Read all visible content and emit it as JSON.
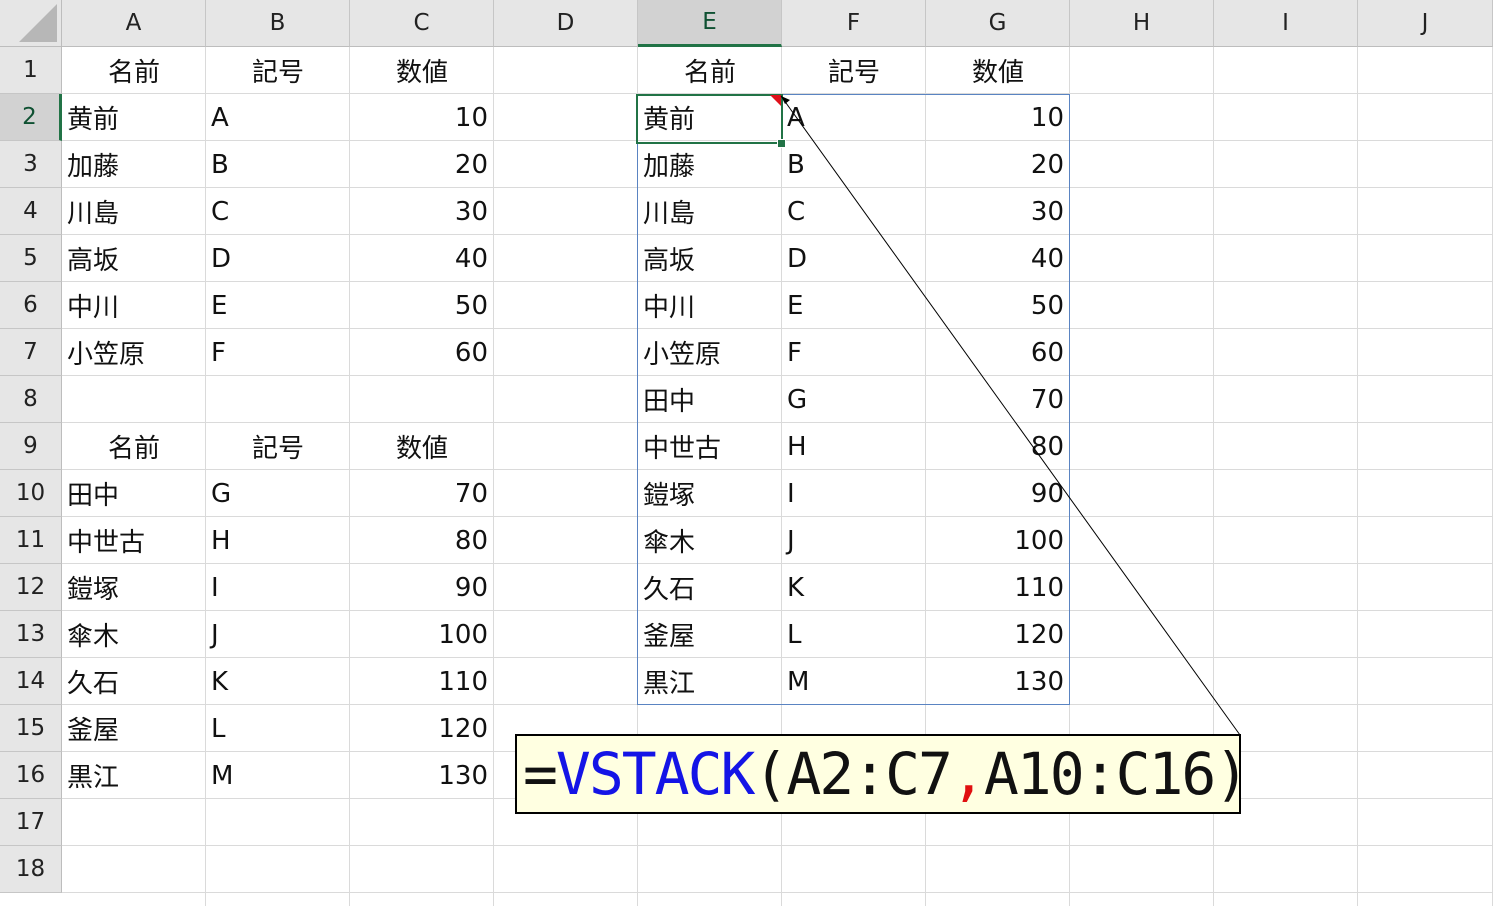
{
  "columns": [
    "A",
    "B",
    "C",
    "D",
    "E",
    "F",
    "G",
    "H",
    "I",
    "J"
  ],
  "rows": [
    "1",
    "2",
    "3",
    "4",
    "5",
    "6",
    "7",
    "8",
    "9",
    "10",
    "11",
    "12",
    "13",
    "14",
    "15",
    "16",
    "17",
    "18"
  ],
  "selected_column": "E",
  "selected_row": "2",
  "table1": {
    "headers": [
      "名前",
      "記号",
      "数値"
    ],
    "rows": [
      [
        "黄前",
        "A",
        "10"
      ],
      [
        "加藤",
        "B",
        "20"
      ],
      [
        "川島",
        "C",
        "30"
      ],
      [
        "高坂",
        "D",
        "40"
      ],
      [
        "中川",
        "E",
        "50"
      ],
      [
        "小笠原",
        "F",
        "60"
      ]
    ]
  },
  "table2": {
    "headers": [
      "名前",
      "記号",
      "数値"
    ],
    "rows": [
      [
        "田中",
        "G",
        "70"
      ],
      [
        "中世古",
        "H",
        "80"
      ],
      [
        "鎧塚",
        "I",
        "90"
      ],
      [
        "傘木",
        "J",
        "100"
      ],
      [
        "久石",
        "K",
        "110"
      ],
      [
        "釜屋",
        "L",
        "120"
      ],
      [
        "黒江",
        "M",
        "130"
      ]
    ]
  },
  "result": {
    "headers": [
      "名前",
      "記号",
      "数値"
    ],
    "rows": [
      [
        "黄前",
        "A",
        "10"
      ],
      [
        "加藤",
        "B",
        "20"
      ],
      [
        "川島",
        "C",
        "30"
      ],
      [
        "高坂",
        "D",
        "40"
      ],
      [
        "中川",
        "E",
        "50"
      ],
      [
        "小笠原",
        "F",
        "60"
      ],
      [
        "田中",
        "G",
        "70"
      ],
      [
        "中世古",
        "H",
        "80"
      ],
      [
        "鎧塚",
        "I",
        "90"
      ],
      [
        "傘木",
        "J",
        "100"
      ],
      [
        "久石",
        "K",
        "110"
      ],
      [
        "釜屋",
        "L",
        "120"
      ],
      [
        "黒江",
        "M",
        "130"
      ]
    ]
  },
  "formula": {
    "eq": "=",
    "func": "VSTACK",
    "open": "(",
    "arg1": "A2:C7",
    "comma": ",",
    "arg2": "A10:C16",
    "close": ")"
  },
  "colors": {
    "func": "#1414e6",
    "comma": "#e01010",
    "text": "#111111",
    "selection": "#217346",
    "spill_border": "#5a84c2",
    "callout_bg": "#ffffe1"
  }
}
